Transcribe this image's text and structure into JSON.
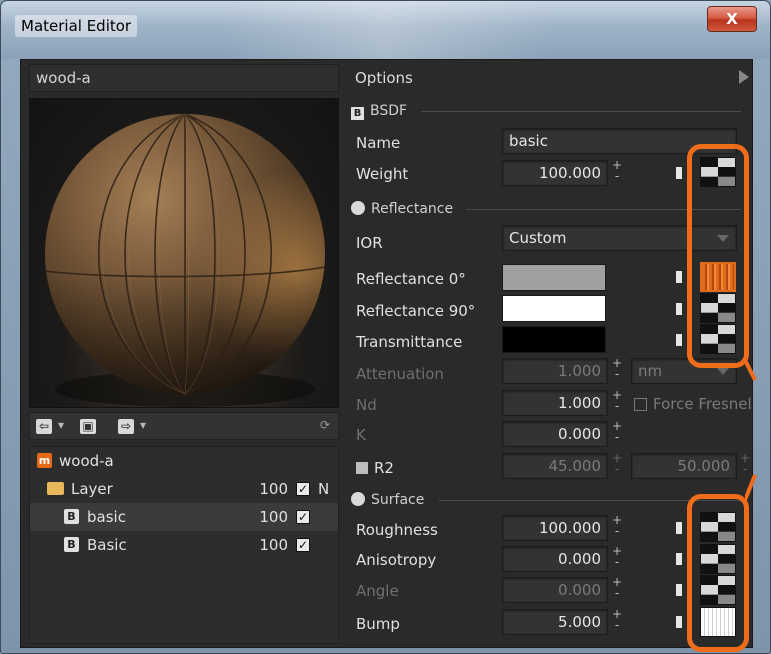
{
  "window": {
    "title": "Material Editor",
    "close_label": "X"
  },
  "material": {
    "name": "wood-a"
  },
  "tree": {
    "items": [
      {
        "label": "wood-a",
        "badge": "m"
      },
      {
        "label": "Layer",
        "value": "100",
        "extra": "N"
      },
      {
        "label": "basic",
        "badge": "B",
        "value": "100"
      },
      {
        "label": "Basic",
        "badge": "B",
        "value": "100"
      }
    ]
  },
  "options": {
    "header": "Options",
    "bsdf": {
      "badge": "B",
      "title": "BSDF"
    },
    "name_label": "Name",
    "name_value": "basic",
    "weight_label": "Weight",
    "weight_value": "100.000",
    "reflectance": {
      "title": "Reflectance",
      "ior_label": "IOR",
      "ior_value": "Custom",
      "refl0_label": "Reflectance 0°",
      "refl0_color": "#a0a0a0",
      "refl90_label": "Reflectance 90°",
      "refl90_color": "#ffffff",
      "trans_label": "Transmittance",
      "trans_color": "#000000",
      "atten_label": "Attenuation",
      "atten_value": "1.000",
      "atten_unit": "nm",
      "nd_label": "Nd",
      "nd_value": "1.000",
      "force_fresnel": "Force Fresnel",
      "k_label": "K",
      "k_value": "0.000",
      "r2_label": "R2",
      "r2_value1": "45.000",
      "r2_value2": "50.000"
    },
    "surface": {
      "title": "Surface",
      "roughness_label": "Roughness",
      "roughness_value": "100.000",
      "anisotropy_label": "Anisotropy",
      "anisotropy_value": "0.000",
      "angle_label": "Angle",
      "angle_value": "0.000",
      "bump_label": "Bump",
      "bump_value": "5.000"
    }
  },
  "colors": {
    "highlight": "#ef6c1a"
  }
}
